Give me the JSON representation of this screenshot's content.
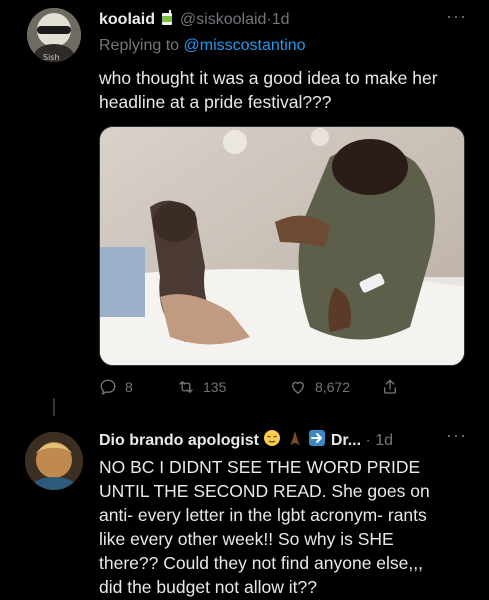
{
  "tweet1": {
    "author_name": "koolaid",
    "author_emoji": "juice-box-emoji",
    "handle": "@siskoolaid",
    "time": "1d",
    "reply_prefix": "Replying to",
    "reply_mention": "@misscostantino",
    "avatar_label": "Sish",
    "text_lines": [
      "who thought it was a good idea to make her",
      "headline at a pride festival???"
    ],
    "stats": {
      "replies": "8",
      "retweets": "135",
      "likes": "8,672"
    }
  },
  "tweet2": {
    "author_name": "Dio brando apologist",
    "author_suffix": "Dr...",
    "time": "1d",
    "text_lines": [
      "NO BC I DIDNT SEE THE WORD PRIDE",
      "UNTIL THE SECOND READ. She goes on",
      "anti- every letter in the lgbt acronym- rants",
      "like every other week!! So why is SHE",
      "there?? Could they not find anyone else,,,",
      "did the budget not allow it??"
    ]
  },
  "icons": {
    "reply": "reply-icon",
    "retweet": "retweet-icon",
    "like": "heart-icon",
    "share": "share-icon",
    "more": "more-icon"
  },
  "colors": {
    "background": "#000000",
    "text": "#e7e9ea",
    "muted": "#71767b",
    "link": "#1d9bf0"
  }
}
